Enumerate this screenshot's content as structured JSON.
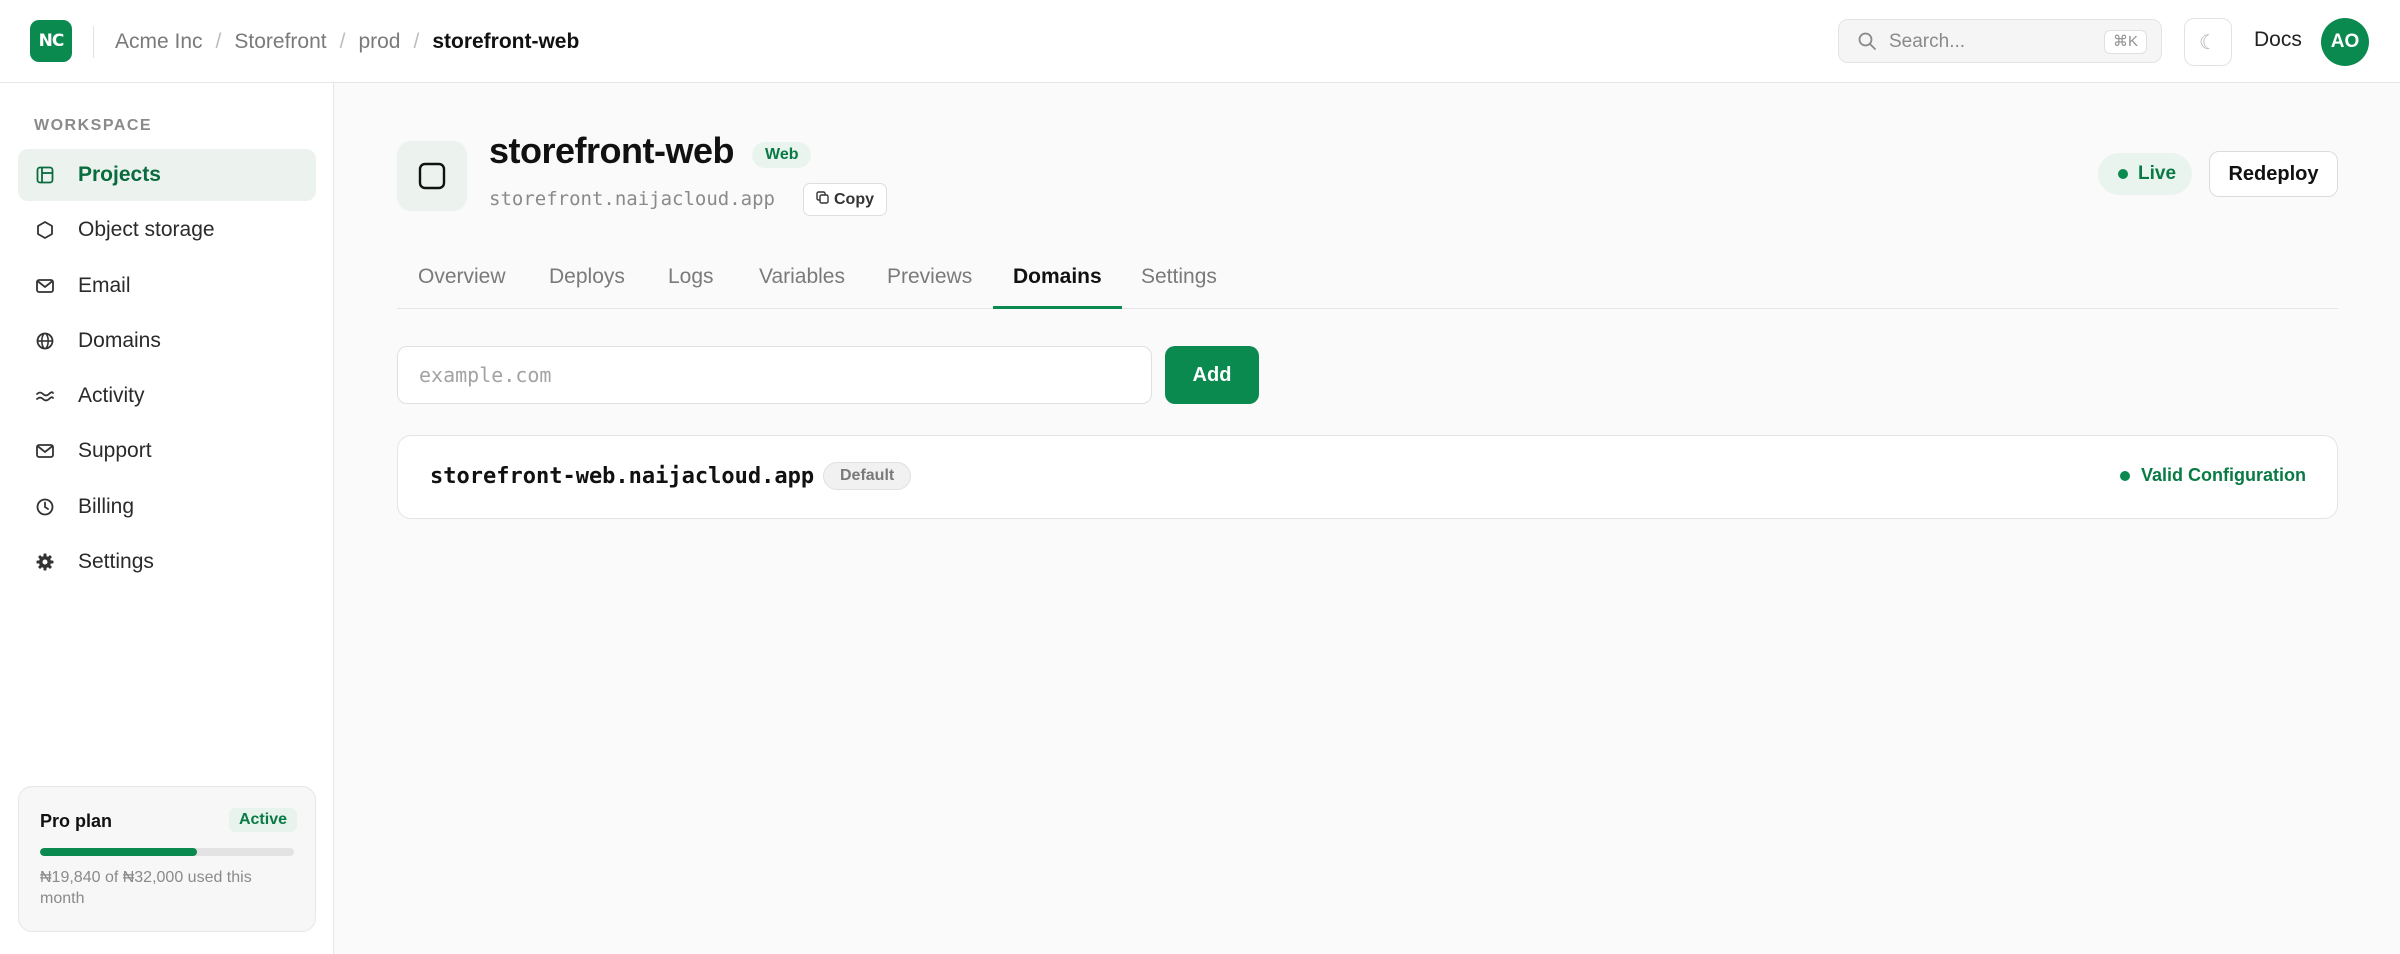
{
  "header": {
    "logo_text": "NC",
    "breadcrumb": [
      "Acme Inc",
      "Storefront",
      "prod",
      "storefront-web"
    ],
    "breadcrumb_separator": "/",
    "search_placeholder": "Search...",
    "search_shortcut": "⌘K",
    "theme_icon": "☾",
    "docs_label": "Docs",
    "avatar_initials": "AO"
  },
  "sidebar": {
    "section_label": "WORKSPACE",
    "items": [
      {
        "label": "Projects",
        "icon": "projects-icon",
        "active": true
      },
      {
        "label": "Object storage",
        "icon": "hexagon-icon",
        "active": false
      },
      {
        "label": "Email",
        "icon": "mail-icon",
        "active": false
      },
      {
        "label": "Domains",
        "icon": "globe-icon",
        "active": false
      },
      {
        "label": "Activity",
        "icon": "activity-icon",
        "active": false
      },
      {
        "label": "Support",
        "icon": "mail-icon",
        "active": false
      },
      {
        "label": "Billing",
        "icon": "clock-icon",
        "active": false
      },
      {
        "label": "Settings",
        "icon": "gear-icon",
        "active": false
      }
    ],
    "plan": {
      "name": "Pro plan",
      "status": "Active",
      "usage_fraction": 0.62,
      "usage_text": "₦19,840 of ₦32,000 used this month"
    }
  },
  "project": {
    "name": "storefront-web",
    "type_badge": "Web",
    "domain": "storefront.naijacloud.app",
    "copy_label": "Copy",
    "status": "Live",
    "redeploy_label": "Redeploy"
  },
  "tabs": [
    {
      "label": "Overview",
      "active": false
    },
    {
      "label": "Deploys",
      "active": false
    },
    {
      "label": "Logs",
      "active": false
    },
    {
      "label": "Variables",
      "active": false
    },
    {
      "label": "Previews",
      "active": false
    },
    {
      "label": "Domains",
      "active": true
    },
    {
      "label": "Settings",
      "active": false
    }
  ],
  "domains": {
    "input_placeholder": "example.com",
    "add_label": "Add",
    "list": [
      {
        "name": "storefront-web.naijacloud.app",
        "badge": "Default",
        "status": "Valid Configuration"
      }
    ]
  },
  "colors": {
    "accent": "#0b8a50",
    "accent_soft": "#eaf4ee",
    "text_muted": "#7a7a7a"
  }
}
